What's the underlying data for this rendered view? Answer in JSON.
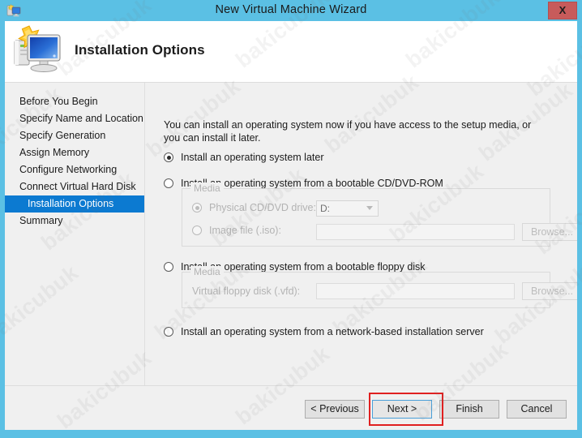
{
  "window": {
    "title": "New Virtual Machine Wizard",
    "close_label": "X",
    "icon": "virtual-machine-icon"
  },
  "header": {
    "title": "Installation Options",
    "icon": "new-virtual-machine-monitor-icon"
  },
  "sidebar": {
    "items": [
      {
        "label": "Before You Begin",
        "selected": false
      },
      {
        "label": "Specify Name and Location",
        "selected": false
      },
      {
        "label": "Specify Generation",
        "selected": false
      },
      {
        "label": "Assign Memory",
        "selected": false
      },
      {
        "label": "Configure Networking",
        "selected": false
      },
      {
        "label": "Connect Virtual Hard Disk",
        "selected": false
      },
      {
        "label": "Installation Options",
        "selected": true
      },
      {
        "label": "Summary",
        "selected": false
      }
    ],
    "selected_color": "#0c7ad1"
  },
  "main": {
    "intro": "You can install an operating system now if you have access to the setup media, or you can install it later.",
    "options": [
      {
        "label": "Install an operating system later",
        "checked": true
      },
      {
        "label": "Install an operating system from a bootable CD/DVD-ROM",
        "checked": false
      },
      {
        "label": "Install an operating system from a bootable floppy disk",
        "checked": false
      },
      {
        "label": "Install an operating system from a network-based installation server",
        "checked": false
      }
    ],
    "cd_media_group": {
      "legend": "Media",
      "disabled": true,
      "physical_drive": {
        "label": "Physical CD/DVD drive:",
        "checked": true,
        "selected_drive": "D:"
      },
      "image_file": {
        "label": "Image file (.iso):",
        "checked": false,
        "value": "",
        "browse_label": "Browse..."
      }
    },
    "floppy_media_group": {
      "legend": "Media",
      "disabled": true,
      "virtual_floppy": {
        "label": "Virtual floppy disk (.vfd):",
        "value": "",
        "browse_label": "Browse..."
      }
    }
  },
  "footer": {
    "buttons": [
      {
        "label": "< Previous",
        "focused": false
      },
      {
        "label": "Next >",
        "focused": true
      },
      {
        "label": "Finish",
        "focused": false
      },
      {
        "label": "Cancel",
        "focused": false
      }
    ],
    "highlight_color": "#e02020",
    "highlighted_button": "Next >"
  },
  "watermark": {
    "text": "bakicubuk"
  },
  "colors": {
    "window_chrome": "#5bc0e4",
    "content_background": "#f0f0f0",
    "close_button": "#c75b5b",
    "accent": "#0c7ad1"
  }
}
